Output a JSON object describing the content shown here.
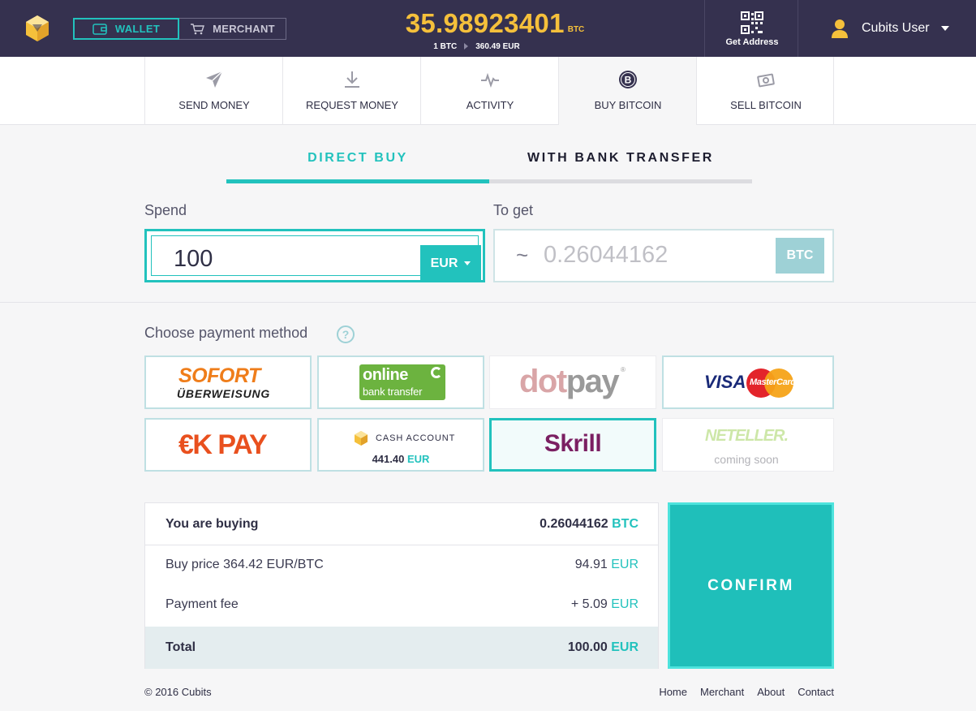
{
  "header": {
    "mode_wallet": "WALLET",
    "mode_merchant": "MERCHANT",
    "balance": "35.98923401",
    "balance_unit": "BTC",
    "rate_from": "1 BTC",
    "rate_to": "360.49 EUR",
    "get_address": "Get Address",
    "user_name": "Cubits User",
    "icons": [
      "cubits-logo-icon",
      "wallet-icon",
      "cart-icon",
      "qr-code-icon",
      "user-icon",
      "chevron-down-icon"
    ]
  },
  "nav": {
    "tabs": [
      {
        "label": "SEND MONEY",
        "icon": "paper-plane-icon"
      },
      {
        "label": "REQUEST MONEY",
        "icon": "download-arrow-icon"
      },
      {
        "label": "ACTIVITY",
        "icon": "pulse-icon"
      },
      {
        "label": "BUY BITCOIN",
        "icon": "bitcoin-icon",
        "active": true
      },
      {
        "label": "SELL BITCOIN",
        "icon": "cash-icon"
      }
    ]
  },
  "buy": {
    "tab_direct": "DIRECT BUY",
    "tab_bank": "WITH BANK TRANSFER",
    "spend_label": "Spend",
    "spend_value": "100",
    "spend_currency": "EUR",
    "get_label": "To get",
    "get_prefix": "~",
    "get_value": "0.26044162",
    "get_currency": "BTC"
  },
  "payment": {
    "title": "Choose payment method",
    "help": "?",
    "sofort_brand": "SOFORT",
    "sofort_sub": "ÜBERWEISUNG",
    "obt_top": "online",
    "obt_bottom": "bank transfer",
    "dotpay_dot": "dot",
    "dotpay_pay": "pay",
    "dotpay_reg": "®",
    "visa": "VISA",
    "mastercard": "MasterCard",
    "okpay": "€K PAY",
    "cash_title": "CASH ACCOUNT",
    "cash_amount": "441.40",
    "cash_currency": "EUR",
    "skrill": "Skrill",
    "neteller": "NETELLER.",
    "neteller_status": "coming soon",
    "selected": "Skrill"
  },
  "summary": {
    "buying_label": "You are buying",
    "buying_amount": "0.26044162",
    "buying_currency": "BTC",
    "price_label": "Buy price 364.42 EUR/BTC",
    "price_amount": "94.91",
    "price_currency": "EUR",
    "fee_label": "Payment fee",
    "fee_amount": "+ 5.09",
    "fee_currency": "EUR",
    "total_label": "Total",
    "total_amount": "100.00",
    "total_currency": "EUR",
    "confirm": "CONFIRM"
  },
  "footer": {
    "copyright": "© 2016 Cubits",
    "links": [
      "Home",
      "Merchant",
      "About",
      "Contact"
    ]
  },
  "colors": {
    "topbar": "#35314f",
    "accent": "#22c2bd",
    "balance": "#f5c03b"
  }
}
